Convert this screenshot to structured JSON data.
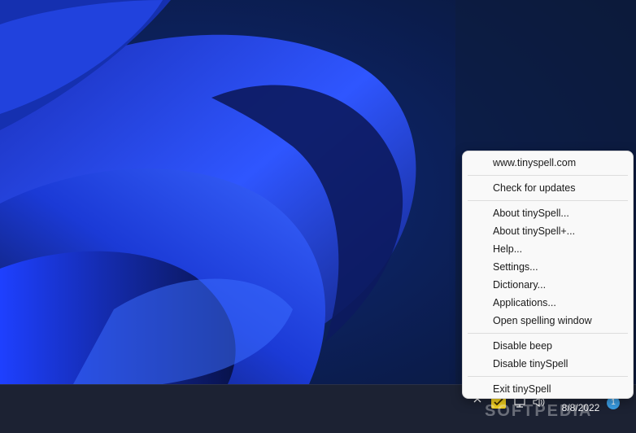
{
  "desktop": {
    "wallpaper": "windows-11-bloom-wallpaper",
    "accent_color": "#1a3be0"
  },
  "context_menu": {
    "groups": [
      [
        {
          "label": "www.tinyspell.com"
        }
      ],
      [
        {
          "label": "Check for updates"
        }
      ],
      [
        {
          "label": "About tinySpell..."
        },
        {
          "label": "About tinySpell+..."
        },
        {
          "label": "Help..."
        },
        {
          "label": "Settings..."
        },
        {
          "label": "Dictionary..."
        },
        {
          "label": "Applications..."
        },
        {
          "label": "Open spelling window"
        }
      ],
      [
        {
          "label": "Disable beep"
        },
        {
          "label": "Disable tinySpell"
        }
      ],
      [
        {
          "label": "Exit tinySpell"
        }
      ]
    ]
  },
  "taskbar": {
    "tray": {
      "show_hidden_icon": "chevron-up-icon",
      "app_icon": "tinyspell-icon",
      "network_icon": "network-icon",
      "volume_icon": "volume-icon"
    },
    "clock": {
      "date": "8/8/2022"
    },
    "notification_count": "1"
  },
  "watermark": "SOFTPEDIA"
}
